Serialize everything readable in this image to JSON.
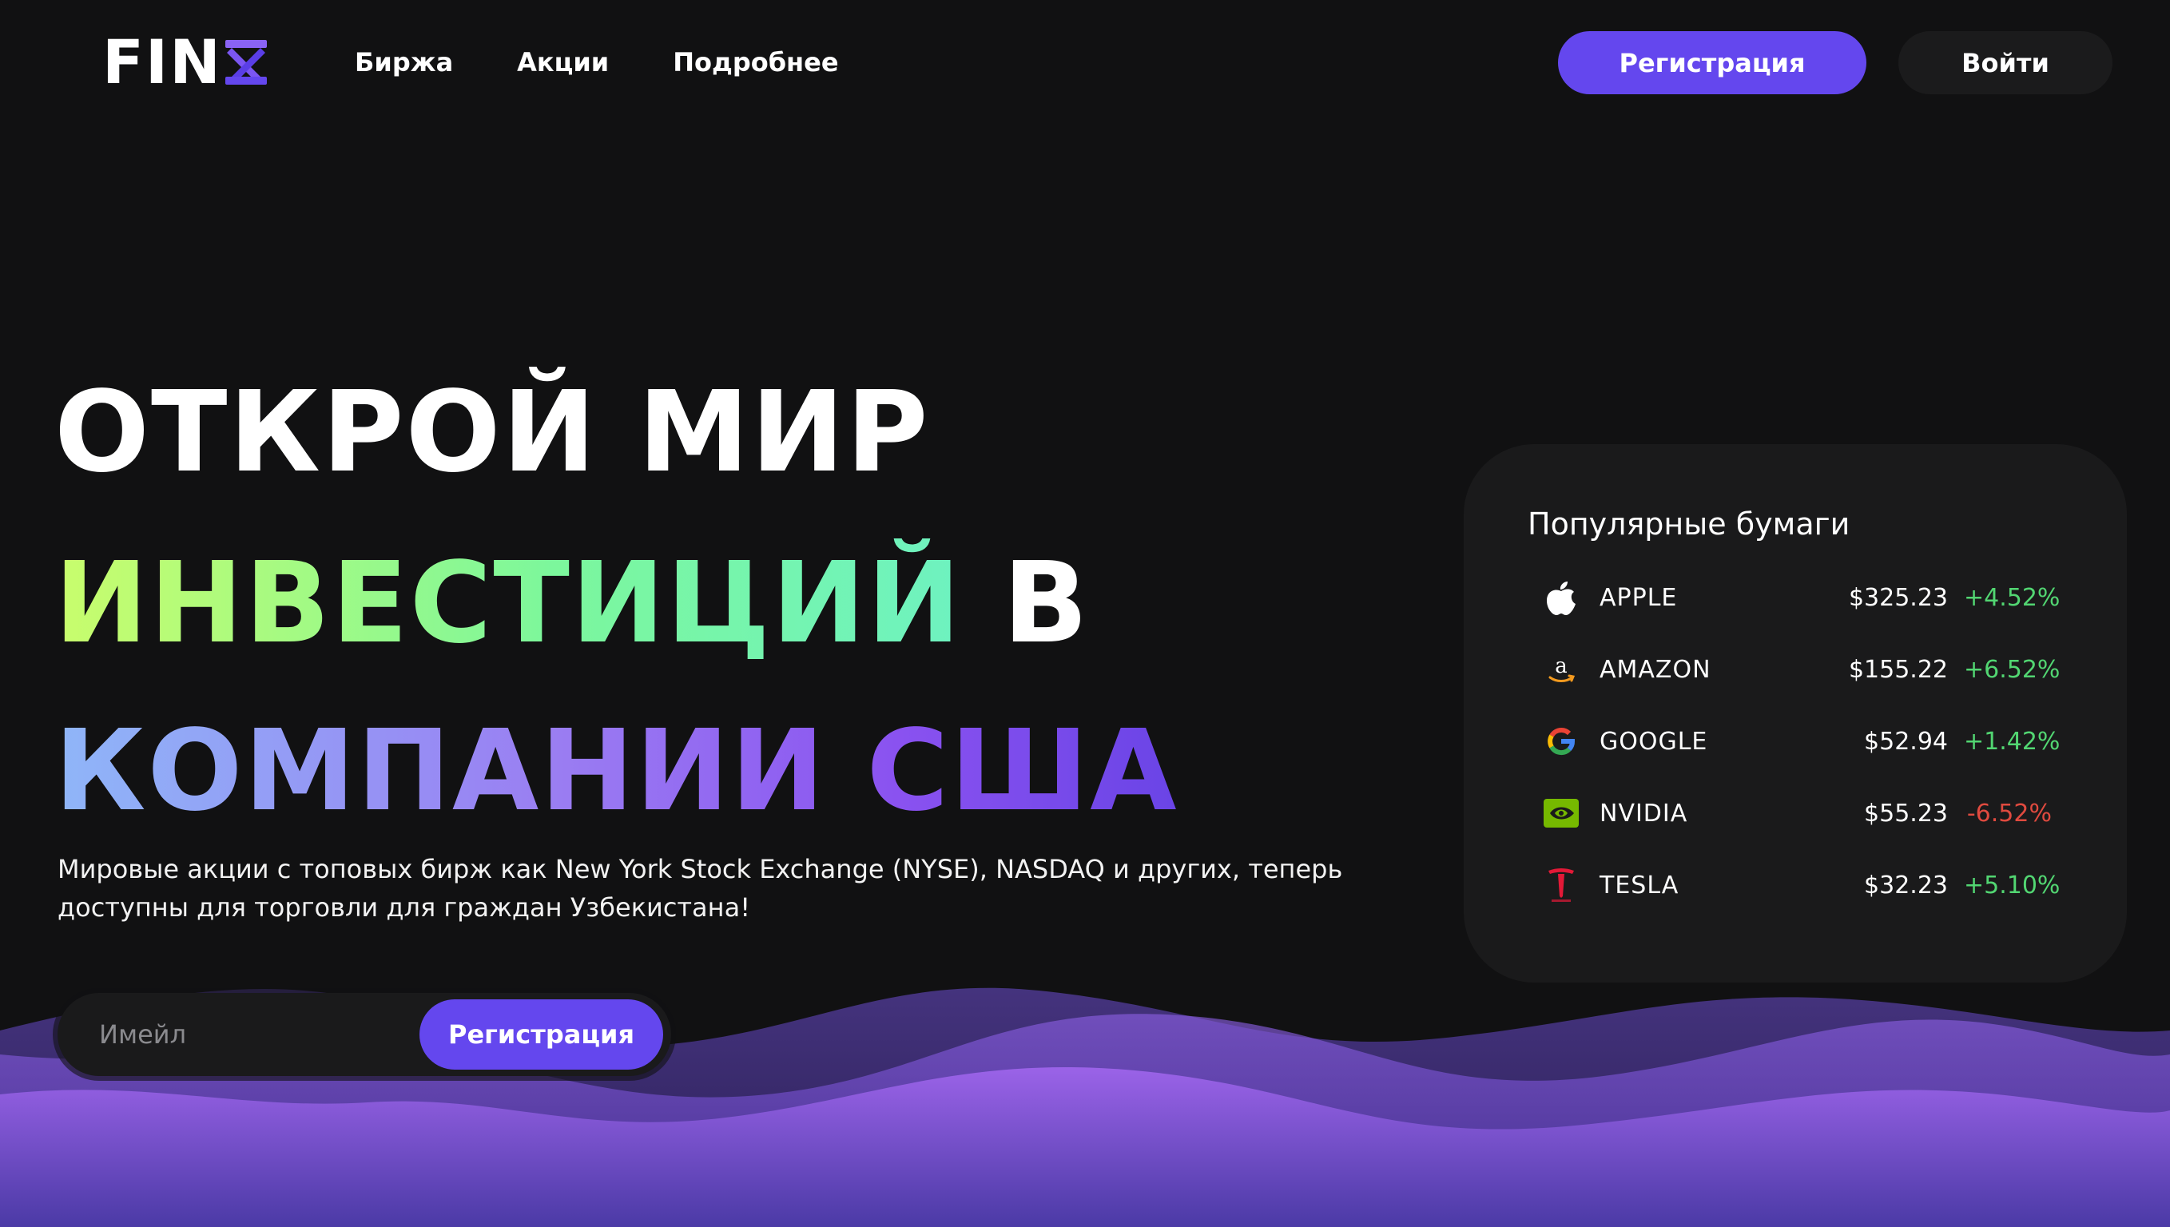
{
  "header": {
    "logo_text": "FIN",
    "nav": [
      "Биржа",
      "Акции",
      "Подробнее"
    ],
    "register_label": "Регистрация",
    "login_label": "Войти"
  },
  "hero": {
    "line1": "ОТКРОЙ МИР",
    "line2_accent": "ИНВЕСТИЦИЙ",
    "line2_rest": "В",
    "line3": "КОМПАНИИ США",
    "subtitle": "Мировые акции с топовых бирж как New York Stock Exchange (NYSE), NASDAQ и других, теперь доступны для торговли для граждан Узбекистана!"
  },
  "form": {
    "email_placeholder": "Имейл",
    "register_label": "Регистрация"
  },
  "popular": {
    "title": "Популярные бумаги",
    "stocks": [
      {
        "name": "APPLE",
        "price": "$325.23",
        "change": "+4.52%",
        "icon": "apple-icon"
      },
      {
        "name": "AMAZON",
        "price": "$155.22",
        "change": "+6.52%",
        "icon": "amazon-icon"
      },
      {
        "name": "GOOGLE",
        "price": "$52.94",
        "change": "+1.42%",
        "icon": "google-icon"
      },
      {
        "name": "NVIDIA",
        "price": "$55.23",
        "change": "-6.52%",
        "icon": "nvidia-icon"
      },
      {
        "name": "TESLA",
        "price": "$32.23",
        "change": "+5.10%",
        "icon": "tesla-icon"
      }
    ]
  },
  "colors": {
    "accent": "#6447ee",
    "positive": "#52d672",
    "negative": "#e04a3f",
    "background": "#111112",
    "card": "#1a1a1b"
  }
}
